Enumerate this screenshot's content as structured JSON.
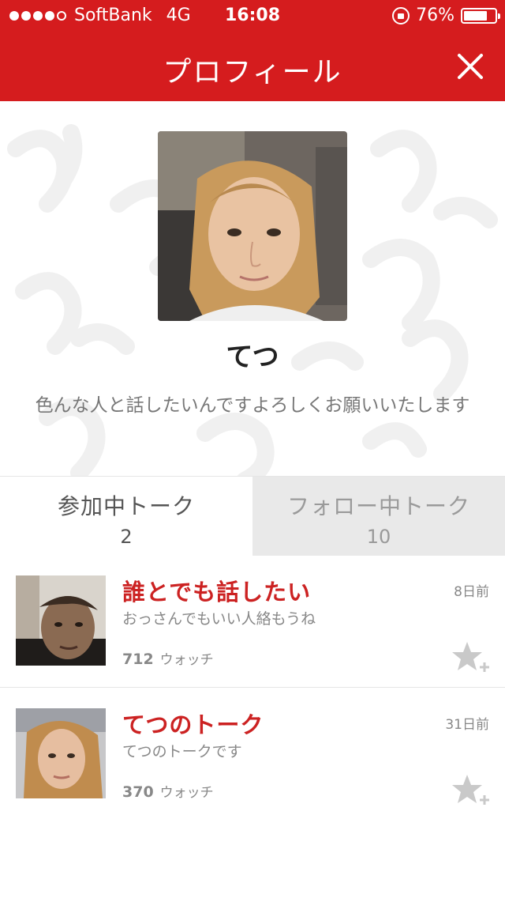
{
  "status_bar": {
    "carrier": "SoftBank",
    "network": "4G",
    "time": "16:08",
    "battery_percent": "76%",
    "battery_level": 0.76,
    "signal_bars_filled": 4,
    "signal_bars_total": 5
  },
  "nav": {
    "title": "プロフィール",
    "close_icon": "close-icon"
  },
  "profile": {
    "name": "てつ",
    "bio": "色んな人と話したいんですよろしくお願いいたします"
  },
  "tabs": [
    {
      "label": "参加中トーク",
      "count": "2",
      "active": true
    },
    {
      "label": "フォロー中トーク",
      "count": "10",
      "active": false
    }
  ],
  "talks": [
    {
      "title": "誰とでも話したい",
      "subtitle": "おっさんでもいい人絡もうね",
      "date": "8日前",
      "watch_count": "712",
      "watch_label": "ウォッチ"
    },
    {
      "title": "てつのトーク",
      "subtitle": "てつのトークです",
      "date": "31日前",
      "watch_count": "370",
      "watch_label": "ウォッチ"
    }
  ],
  "colors": {
    "brand_red": "#d51c1e",
    "title_red": "#cc2222",
    "inactive_tab": "#e9e9e9"
  }
}
